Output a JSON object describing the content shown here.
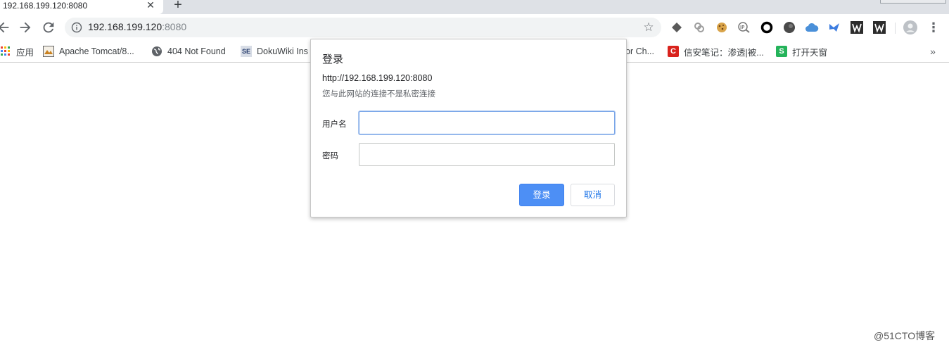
{
  "tab": {
    "title": "192.168.199.120:8080",
    "close_glyph": "✕",
    "new_tab_glyph": "+"
  },
  "toolbar": {
    "back_icon": "back-arrow-icon",
    "forward_icon": "forward-arrow-icon",
    "reload_icon": "reload-icon",
    "url_host": "192.168.199.120",
    "url_port": ":8080",
    "star_glyph": "☆",
    "menu_glyph": "⋮",
    "extensions": [
      "layers-extension-icon",
      "link-extension-icon",
      "cookie-extension-icon",
      "ip-extension-icon",
      "ring-extension-icon",
      "dark-circle-extension-icon",
      "cloud-extension-icon",
      "bird-extension-icon",
      "wappalyzer-extension-icon",
      "wappalyzer-alt-extension-icon"
    ],
    "profile_icon": "profile-avatar-icon"
  },
  "bookmarks": {
    "items": [
      {
        "label": "应用",
        "icon": "apps-grid-icon"
      },
      {
        "label": "Apache Tomcat/8...",
        "icon": "tomcat-icon"
      },
      {
        "label": "404 Not Found",
        "icon": "globe-icon"
      },
      {
        "label": "DokuWiki Ins",
        "icon": "se-icon",
        "icon_text": "SE"
      },
      {
        "label": "or Ch...",
        "icon": ""
      },
      {
        "label": "信安笔记：渗透|被...",
        "icon": "c-brand-icon",
        "icon_text": "C"
      },
      {
        "label": "打开天窗",
        "icon": "s-brand-icon",
        "icon_text": "S"
      }
    ],
    "more_glyph": "»"
  },
  "dialog": {
    "title": "登录",
    "origin": "http://192.168.199.120:8080",
    "note": "您与此网站的连接不是私密连接",
    "username_label": "用户名",
    "username_value": "",
    "password_label": "密码",
    "password_value": "",
    "ok_label": "登录",
    "cancel_label": "取消"
  },
  "watermark": "@51CTO博客",
  "colors": {
    "tabstrip": "#dee1e6",
    "omnibox": "#f1f3f4",
    "primary_button": "#4d8ff5",
    "cancel_text": "#1a73e8",
    "focus_border": "#7aa6e8"
  }
}
